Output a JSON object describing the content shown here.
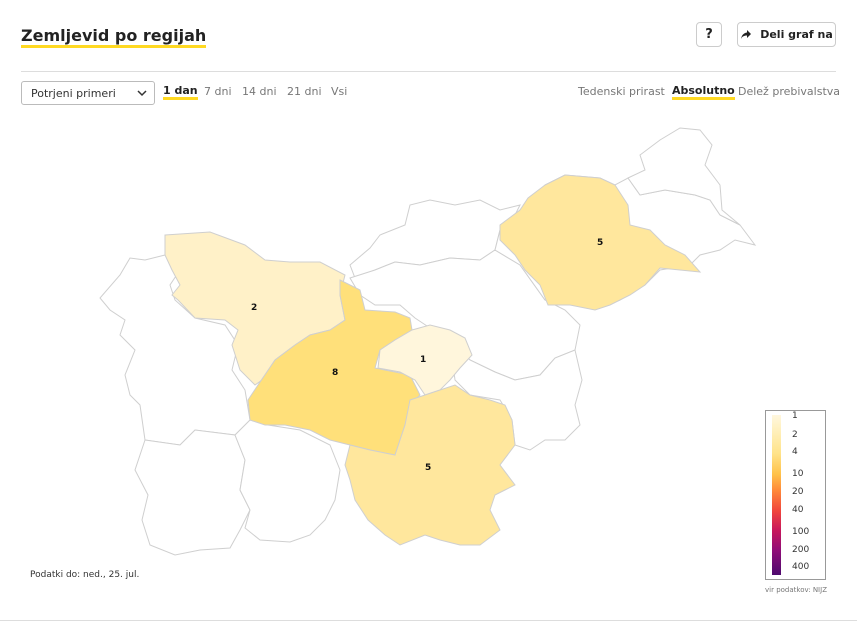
{
  "header": {
    "title": "Zemljevid po regijah",
    "help_label": "?",
    "share_label": "Deli graf na"
  },
  "controls": {
    "select_value": "Potrjeni primeri",
    "ranges": [
      "1 dan",
      "7 dni",
      "14 dni",
      "21 dni",
      "Vsi"
    ],
    "active_range": "1 dan",
    "modes": [
      "Tedenski prirast",
      "Absolutno",
      "Delež prebivalstva"
    ],
    "active_mode": "Absolutno"
  },
  "map": {
    "regions": [
      {
        "name": "Gorenjska",
        "value": 2,
        "color": "#fff1c8"
      },
      {
        "name": "Osrednjeslovenska",
        "value": 8,
        "color": "#ffe07a"
      },
      {
        "name": "Zasavska",
        "value": 1,
        "color": "#fff6dc"
      },
      {
        "name": "Jugovzhodna Slovenija",
        "value": 5,
        "color": "#ffe79d"
      },
      {
        "name": "Pomurska",
        "value": 5,
        "color": "#ffe79d"
      }
    ],
    "empty_color": "#ffffff"
  },
  "legend": {
    "labels": [
      "1",
      "2",
      "4",
      "10",
      "20",
      "40",
      "100",
      "200",
      "400"
    ],
    "colors": [
      "#fff7de",
      "#ffeeb4",
      "#ffe38a",
      "#ffc24a",
      "#ff8a3a",
      "#f0453c",
      "#c8175b",
      "#8e0d78",
      "#4d0a6e"
    ]
  },
  "footer": {
    "data_date": "Podatki do: ned., 25. jul.",
    "source": "vir podatkov: NIJZ"
  }
}
